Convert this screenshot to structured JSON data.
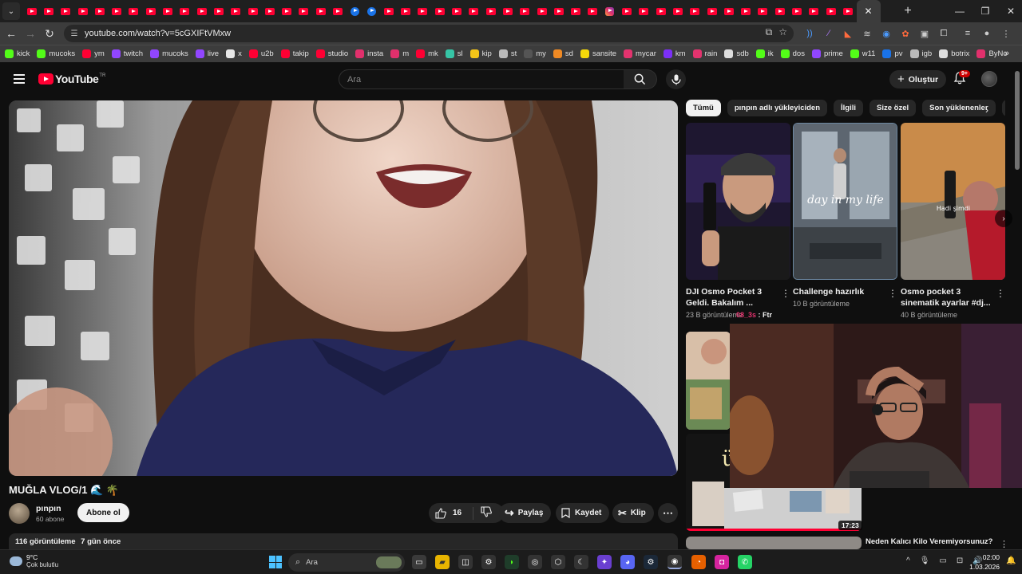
{
  "browser": {
    "tab_count_red": 49,
    "active_tab_close": "✕",
    "new_tab": "+",
    "url": "youtube.com/watch?v=5cGXIFtVMxw",
    "bookmarks": [
      {
        "label": "kick",
        "color": "#53fc18"
      },
      {
        "label": "mucoks",
        "color": "#53fc18"
      },
      {
        "label": "ym",
        "color": "#ff0033"
      },
      {
        "label": "twitch",
        "color": "#9146ff"
      },
      {
        "label": "mucoks",
        "color": "#9146ff"
      },
      {
        "label": "live",
        "color": "#9146ff"
      },
      {
        "label": "x",
        "color": "#e7e7e7"
      },
      {
        "label": "u2b",
        "color": "#ff0033"
      },
      {
        "label": "takip",
        "color": "#ff0033"
      },
      {
        "label": "studio",
        "color": "#ff0033"
      },
      {
        "label": "insta",
        "color": "#e1306c"
      },
      {
        "label": "m",
        "color": "#e1306c"
      },
      {
        "label": "mk",
        "color": "#ff0033"
      },
      {
        "label": "sl",
        "color": "#36c5a6"
      },
      {
        "label": "kip",
        "color": "#f5c518"
      },
      {
        "label": "st",
        "color": "#bbbbbb"
      },
      {
        "label": "my",
        "color": "#555555"
      },
      {
        "label": "sd",
        "color": "#f08a24"
      },
      {
        "label": "sansite",
        "color": "#f5d90a"
      },
      {
        "label": "mycar",
        "color": "#e3336e"
      },
      {
        "label": "km",
        "color": "#7b2ff7"
      },
      {
        "label": "rain",
        "color": "#e3336e"
      },
      {
        "label": "sdb",
        "color": "#dddddd"
      },
      {
        "label": "ik",
        "color": "#53fc18"
      },
      {
        "label": "dos",
        "color": "#53fc18"
      },
      {
        "label": "prime",
        "color": "#9146ff"
      },
      {
        "label": "w11",
        "color": "#53fc18"
      },
      {
        "label": "pv",
        "color": "#1a73e8"
      },
      {
        "label": "igb",
        "color": "#bbbbbb"
      },
      {
        "label": "botrix",
        "color": "#dddddd"
      },
      {
        "label": "ByNo",
        "color": "#e1306c"
      }
    ]
  },
  "youtube": {
    "logo_text": "YouTube",
    "logo_region": "TR",
    "search_placeholder": "Ara",
    "create_label": "Oluştur",
    "notification_badge": "9+",
    "video": {
      "title": "MUĞLA VLOG/1 🌊 🌴",
      "channel": "pınpın",
      "subscribers": "60 abone",
      "subscribe_label": "Abone ol",
      "likes": "16",
      "share_label": "Paylaş",
      "save_label": "Kaydet",
      "clip_label": "Klip",
      "views": "116 görüntüleme",
      "age": "7 gün önce"
    },
    "chips": [
      "Tümü",
      "pınpın adlı yükleyiciden",
      "İlgili",
      "Size özel",
      "Son yüklenenler",
      "İz"
    ],
    "related": [
      {
        "title": "DJI Osmo Pocket 3 Geldi. Bakalım ...",
        "meta": "23 B görüntüleme"
      },
      {
        "title": "Challenge hazırlık",
        "meta": "10 B görüntüleme"
      },
      {
        "title": "Osmo pocket 3 sinematik ayarlar #dj...",
        "meta": "40 B görüntüleme",
        "badge": "Hadi şimdi"
      }
    ],
    "thumb2_overlay_text": "day in my life",
    "overlay_label_prefix": "08_3s",
    "overlay_label_suffix": ": Ftr",
    "side_video_duration": "17:23",
    "side_video_title": "Neden Kalıcı Kilo Veremiyorsunuz?"
  },
  "taskbar": {
    "temperature": "9°C",
    "weather": "Çok bulutlu",
    "search_label": "Ara",
    "time": "02:00",
    "date": "1.03.2026"
  }
}
